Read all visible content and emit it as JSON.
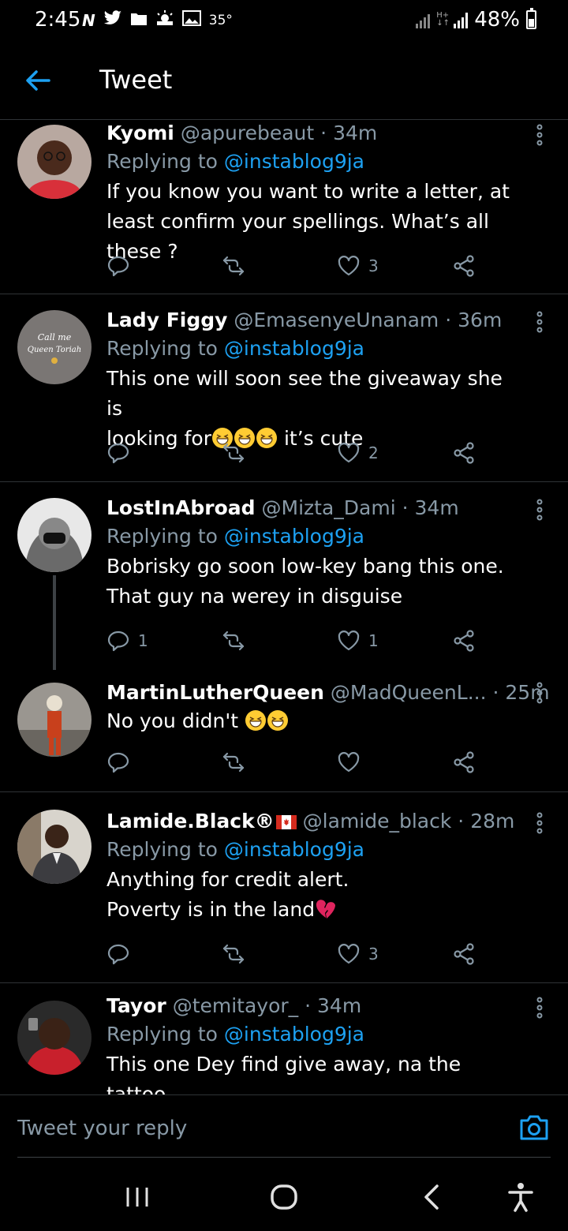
{
  "status_bar": {
    "time": "2:45",
    "temperature": "35°",
    "battery": "48%",
    "icons_left": [
      "n-icon",
      "twitter-bird-icon",
      "folder-icon",
      "weather-icon",
      "gallery-icon"
    ]
  },
  "header": {
    "title": "Tweet"
  },
  "tweets": [
    {
      "name": "Kyomi",
      "handle": "@apurebeaut",
      "time": "34m",
      "replying_label": "Replying to",
      "replying_to": "@instablog9ja",
      "text": "If you know you want to write a letter, at least confirm your spellings. What’s all these ?",
      "replies": "",
      "retweets": "",
      "likes": "3"
    },
    {
      "name": "Lady Figgy",
      "handle": "@EmasenyeUnanam",
      "time": "36m",
      "replying_label": "Replying to",
      "replying_to": "@instablog9ja",
      "text_line1": "This one will soon see the giveaway she is",
      "text_line2_a": "looking for",
      "text_line2_b": " it’s cute",
      "avatar_text_1": "Call me",
      "avatar_text_2": "Queen Toriah",
      "replies": "",
      "retweets": "",
      "likes": "2"
    },
    {
      "name": "LostInAbroad",
      "handle": "@Mizta_Dami",
      "time": "34m",
      "replying_label": "Replying to",
      "replying_to": "@instablog9ja",
      "text": "Bobrisky go soon low-key bang this one. That guy na werey in disguise",
      "replies": "1",
      "retweets": "",
      "likes": "1"
    },
    {
      "name": "MartinLutherQueen",
      "handle": "@MadQueenL...",
      "time": "25m",
      "text": "No you didn't ",
      "replies": "",
      "retweets": "",
      "likes": ""
    },
    {
      "name": "Lamide.Black®",
      "handle": "@lamide_black",
      "time": "28m",
      "replying_label": "Replying to",
      "replying_to": "@instablog9ja",
      "text_line1": "Anything for credit alert.",
      "text_line2": "Poverty is in the land",
      "replies": "",
      "retweets": "",
      "likes": "3"
    },
    {
      "name": "Tayor",
      "handle": "@temitayor_",
      "time": "34m",
      "replying_label": "Replying to",
      "replying_to": "@instablog9ja",
      "text": "This one Dey find give away, na the tattoo"
    }
  ],
  "reply_bar": {
    "placeholder": "Tweet your reply"
  },
  "colors": {
    "accent": "#1da1f2",
    "muted": "#8899a6",
    "background": "#000000",
    "divider": "#2f3336"
  }
}
